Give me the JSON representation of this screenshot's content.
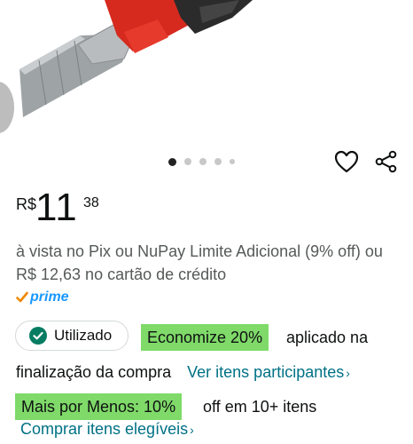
{
  "gallery": {
    "dots_total": 5,
    "active_dot": 1
  },
  "price": {
    "currency": "R$",
    "whole": "11",
    "fraction": "38"
  },
  "payment_text": "à vista no Pix ou NuPay Limite Adicional (9% off) ou R$ 12,63 no cartão de crédito",
  "prime": {
    "label": "prime",
    "check_color": "#f08804",
    "text_color": "#1a98ff"
  },
  "coupon": {
    "status_label": "Utilizado",
    "discount_label": "Economize 20%",
    "applied_text": "aplicado na",
    "checkout_text": "finalização da compra",
    "link_label": "Ver itens participantes",
    "highlight_color": "#7fda69"
  },
  "promo": {
    "badge_label": "Mais por Menos: 10%",
    "detail_text": "off em 10+ itens",
    "link_label": "Comprar itens elegíveis"
  },
  "colors": {
    "link": "#007185",
    "secondary_text": "#565959"
  }
}
